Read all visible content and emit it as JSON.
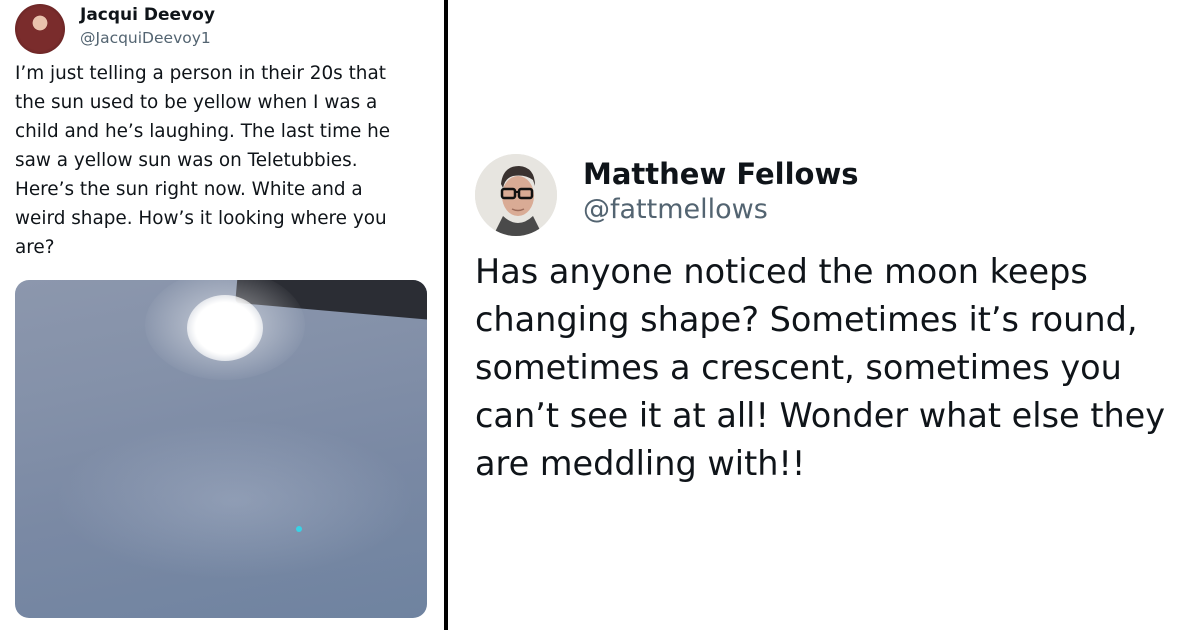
{
  "left_tweet": {
    "name": "Jacqui Deevoy",
    "handle": "@JacquiDeevoy1",
    "text_lines": [
      "I’m just telling a person in their 20s that",
      "the sun used to be yellow when I was a",
      "child and he’s laughing. The last time he",
      "saw a yellow sun was on Teletubbies.",
      "Here’s the sun right now. White and a",
      "weird shape. How’s it looking where you",
      "are?"
    ]
  },
  "right_tweet": {
    "name": "Matthew Fellows",
    "handle": "@fattmellows",
    "text_lines": [
      "Has anyone noticed the moon keeps",
      "changing shape? Sometimes it’s round,",
      "sometimes a crescent, sometimes you",
      "can’t see it at all! Wonder what else they",
      "are meddling with!!"
    ]
  },
  "colors": {
    "text": "#0f1419",
    "handle": "#536471",
    "divider": "#000000"
  }
}
